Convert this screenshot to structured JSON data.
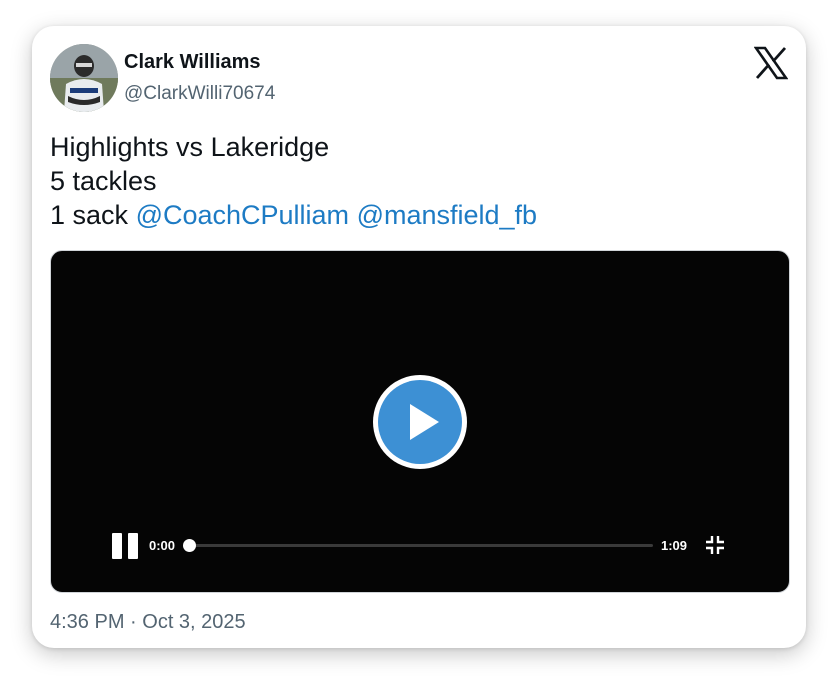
{
  "author": {
    "name": "Clark Williams",
    "handle": "@ClarkWilli70674",
    "avatar_icon": "player-photo-avatar"
  },
  "brand": {
    "logo_icon": "x-logo-icon"
  },
  "tweet": {
    "line1": "Highlights vs Lakeridge",
    "line2": "5 tackles",
    "line3_prefix": "1 sack",
    "mentions": [
      "@CoachCPulliam",
      "@mansfield_fb"
    ]
  },
  "video": {
    "current_time": "0:00",
    "total_time": "1:09",
    "progress_fraction": 0,
    "play_icon": "play-icon",
    "pause_icon": "pause-icon",
    "exit_fullscreen_icon": "exit-fullscreen-icon"
  },
  "timestamp": "4:36 PM · Oct 3, 2025",
  "colors": {
    "link": "#1d7bc4",
    "play_button": "#3d90d4",
    "secondary_text": "#536471",
    "video_background": "#050505"
  }
}
